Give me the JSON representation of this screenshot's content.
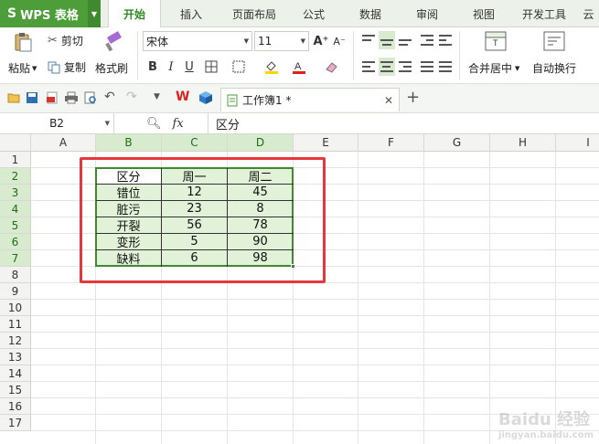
{
  "app": {
    "brand": "WPS 表格",
    "brand_logo": "S"
  },
  "ribbon_tabs": [
    "开始",
    "插入",
    "页面布局",
    "公式",
    "数据",
    "审阅",
    "视图",
    "开发工具",
    "云"
  ],
  "ribbon": {
    "paste": "粘贴",
    "cut": "剪切",
    "copy": "复制",
    "format_painter": "格式刷",
    "font_name": "宋体",
    "font_size": "11",
    "bold": "B",
    "italic": "I",
    "underline": "U",
    "merge_center": "合并居中",
    "wrap_text": "自动换行",
    "font_grow": "A⁺",
    "font_shrink": "A⁻"
  },
  "doc_tab": {
    "title": "工作簿1 *"
  },
  "formula_bar": {
    "name_box": "B2",
    "fx": "fx",
    "value": "区分"
  },
  "columns": [
    "A",
    "B",
    "C",
    "D",
    "E",
    "F",
    "G",
    "H",
    "I"
  ],
  "rows": [
    "1",
    "2",
    "3",
    "4",
    "5",
    "6",
    "7",
    "8",
    "9",
    "10",
    "11",
    "12",
    "13",
    "14",
    "15",
    "16",
    "17"
  ],
  "table": {
    "header": [
      "区分",
      "周一",
      "周二"
    ],
    "rows": [
      [
        "错位",
        "12",
        "45"
      ],
      [
        "脏污",
        "23",
        "8"
      ],
      [
        "开裂",
        "56",
        "78"
      ],
      [
        "变形",
        "5",
        "90"
      ],
      [
        "缺料",
        "6",
        "98"
      ]
    ]
  },
  "watermark": {
    "text": "Baidu 经验",
    "sub": "jingyan.baidu.com"
  },
  "colors": {
    "accent": "#4d9e3a",
    "selection_fill": "#e2f2d8",
    "highlight": "#e5373d"
  }
}
